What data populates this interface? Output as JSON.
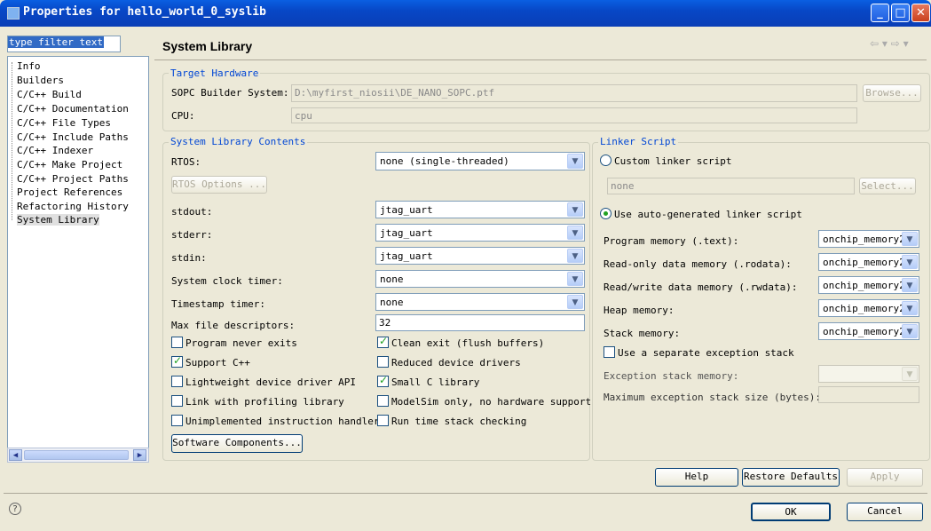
{
  "window": {
    "title": "Properties for hello_world_0_syslib"
  },
  "filter": {
    "text": "type filter text"
  },
  "tree": {
    "items": [
      "Info",
      "Builders",
      "C/C++ Build",
      "C/C++ Documentation",
      "C/C++ File Types",
      "C/C++ Include Paths",
      "C/C++ Indexer",
      "C/C++ Make Project",
      "C/C++ Project Paths",
      "Project References",
      "Refactoring History",
      "System Library"
    ]
  },
  "page": {
    "title": "System Library",
    "nav": "⇦ ▾ ⇨ ▾"
  },
  "target_hardware": {
    "legend": "Target Hardware",
    "sopc_label": "SOPC Builder System:",
    "sopc_value": "D:\\myfirst_niosii\\DE_NANO_SOPC.ptf",
    "browse": "Browse...",
    "cpu_label": "CPU:",
    "cpu_value": "cpu"
  },
  "contents": {
    "legend": "System Library Contents",
    "rtos_label": "RTOS:",
    "rtos_value": "none (single-threaded)",
    "rtos_options": "RTOS Options ...",
    "stdout_label": "stdout:",
    "stdout_value": "jtag_uart",
    "stderr_label": "stderr:",
    "stderr_value": "jtag_uart",
    "stdin_label": "stdin:",
    "stdin_value": "jtag_uart",
    "sysclk_label": "System clock timer:",
    "sysclk_value": "none",
    "timestamp_label": "Timestamp timer:",
    "timestamp_value": "none",
    "maxfd_label": "Max file descriptors:",
    "maxfd_value": "32",
    "checks": {
      "program_never_exits": "Program never exits",
      "clean_exit": "Clean exit (flush buffers)",
      "support_cpp": "Support C++",
      "reduced_drivers": "Reduced device drivers",
      "lightweight_api": "Lightweight device driver API",
      "small_c": "Small C library",
      "profiling": "Link with profiling library",
      "modelsim": "ModelSim only, no hardware support",
      "unimplemented": "Unimplemented instruction handler",
      "stack_check": "Run time stack checking"
    },
    "software_components": "Software Components..."
  },
  "linker": {
    "legend": "Linker Script",
    "custom": "Custom linker script",
    "custom_value": "none",
    "select": "Select...",
    "auto": "Use auto-generated linker script",
    "program_mem_label": "Program memory (.text):",
    "program_mem_value": "onchip_memory2",
    "rodata_label": "Read-only data memory (.rodata):",
    "rodata_value": "onchip_memory2",
    "rwdata_label": "Read/write data memory (.rwdata):",
    "rwdata_value": "onchip_memory2",
    "heap_label": "Heap memory:",
    "heap_value": "onchip_memory2",
    "stack_label": "Stack memory:",
    "stack_value": "onchip_memory2",
    "sep_exception": "Use a separate exception stack",
    "exc_mem_label": "Exception stack memory:",
    "exc_size_label": "Maximum exception stack size (bytes):"
  },
  "buttons": {
    "help": "Help",
    "restore": "Restore Defaults",
    "apply": "Apply",
    "ok": "OK",
    "cancel": "Cancel"
  }
}
